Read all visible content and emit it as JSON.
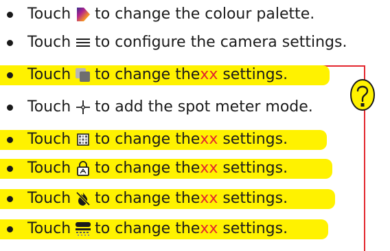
{
  "items": [
    {
      "icon": "colour-palette-icon",
      "touch": "Touch",
      "before": "to change the colour palette.",
      "red": "",
      "after": "",
      "highlight": false
    },
    {
      "icon": "menu-icon",
      "touch": "Touch",
      "before": "to configure the camera settings.",
      "red": "",
      "after": "",
      "highlight": false
    },
    {
      "icon": "overlay-squares-icon",
      "touch": "Touch",
      "before": "to change the ",
      "red": "xx",
      "after": " settings.",
      "highlight": true
    },
    {
      "icon": "crosshair-icon",
      "touch": "Touch",
      "before": "to add the spot meter mode.",
      "red": "",
      "after": "",
      "highlight": false
    },
    {
      "icon": "grid-pattern-icon",
      "touch": "Touch",
      "before": "to change the ",
      "red": "xx",
      "after": " settings.",
      "highlight": true
    },
    {
      "icon": "thermometer-lock-icon",
      "touch": "Touch",
      "before": "to change the ",
      "red": "xx",
      "after": " settings.",
      "highlight": true
    },
    {
      "icon": "no-flame-icon",
      "touch": "Touch",
      "before": "to change the ",
      "red": "xx",
      "after": " settings.",
      "highlight": true
    },
    {
      "icon": "gradient-bar-icon",
      "touch": "Touch",
      "before": "to change the ",
      "red": "xx",
      "after": " settings.",
      "highlight": true
    }
  ],
  "help_icon": "question-mark-icon",
  "colors": {
    "highlight": "#fff200",
    "accent": "#e3262d",
    "text": "#1a1a1a"
  }
}
